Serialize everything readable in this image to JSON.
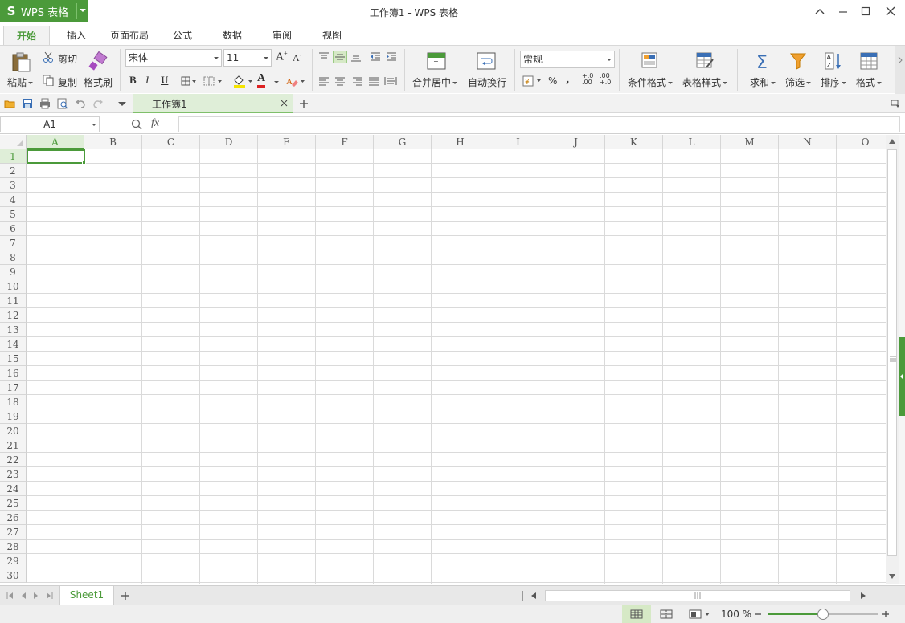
{
  "app": {
    "name": "WPS 表格",
    "logo": "S",
    "window_title": "工作簿1 - WPS 表格",
    "accent": "#4b9a3a"
  },
  "menu_tabs": [
    "开始",
    "插入",
    "页面布局",
    "公式",
    "数据",
    "审阅",
    "视图"
  ],
  "active_tab": "开始",
  "ribbon": {
    "paste": "粘贴",
    "cut": "剪切",
    "copy": "复制",
    "format_painter": "格式刷",
    "font_name": "宋体",
    "font_size": "11",
    "merge_center": "合并居中",
    "wrap_text": "自动换行",
    "number_format": "常规",
    "percent": "%",
    "comma": ",",
    "inc_decimal": "+.0\n.00",
    "dec_decimal": ".00\n+.0",
    "conditional_format": "条件格式",
    "table_style": "表格样式",
    "sum": "求和",
    "filter": "筛选",
    "sort": "排序",
    "format": "格式",
    "bold": "B",
    "italic": "I",
    "underline": "U",
    "font_color_letter": "A",
    "grow_font": "A",
    "shrink_font": "A"
  },
  "document_tab": "工作簿1",
  "formula_bar": {
    "name_box": "A1",
    "fx_label": "fx",
    "value": ""
  },
  "columns": [
    "A",
    "B",
    "C",
    "D",
    "E",
    "F",
    "G",
    "H",
    "I",
    "J",
    "K",
    "L",
    "M",
    "N",
    "O"
  ],
  "rows": [
    "1",
    "2",
    "3",
    "4",
    "5",
    "6",
    "7",
    "8",
    "9",
    "10",
    "11",
    "12",
    "13",
    "14",
    "15",
    "16",
    "17",
    "18",
    "19",
    "20",
    "21",
    "22",
    "23",
    "24",
    "25",
    "26",
    "27",
    "28",
    "29",
    "30"
  ],
  "selected_cell": "A1",
  "sheets": [
    "Sheet1"
  ],
  "status": {
    "zoom": "100 %",
    "zoom_fraction": 0.5
  }
}
